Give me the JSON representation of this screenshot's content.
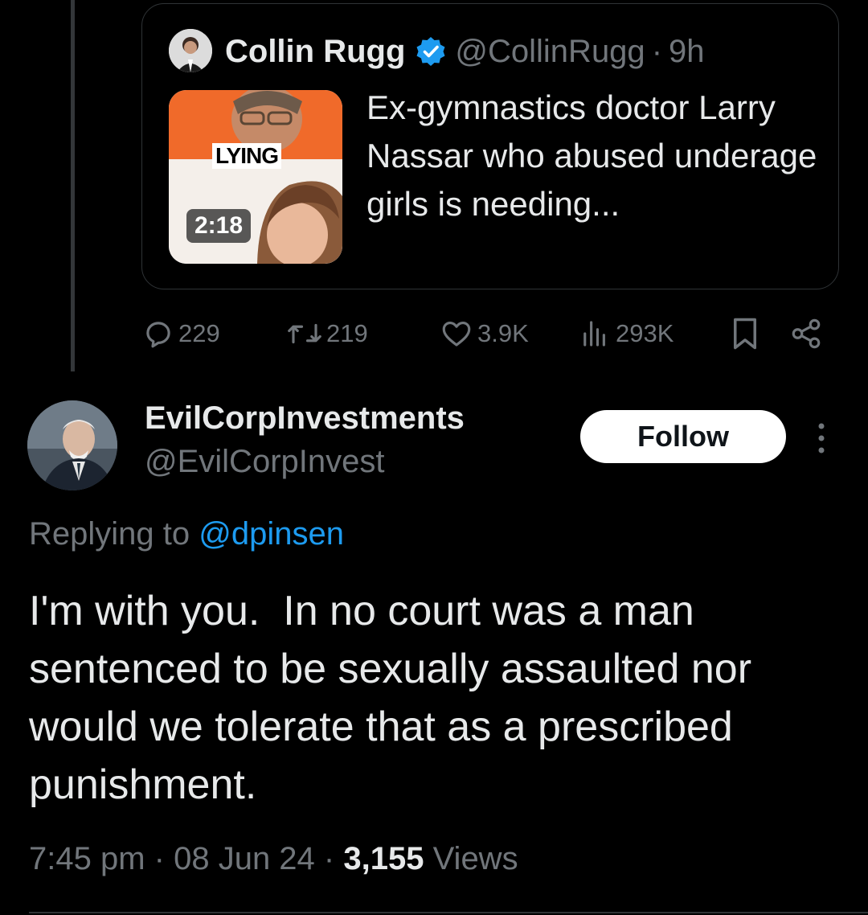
{
  "quoted_tweet": {
    "author_name": "Collin Rugg",
    "author_handle": "@CollinRugg",
    "separator": "·",
    "age": "9h",
    "text": "Ex-gymnastics doctor Larry Nassar who abused underage girls is needing...",
    "media": {
      "caption": "LYING",
      "duration": "2:18"
    }
  },
  "actions": {
    "replies": "229",
    "reposts": "219",
    "likes": "3.9K",
    "views": "293K"
  },
  "reply_tweet": {
    "author_name": "EvilCorpInvestments",
    "author_handle": "@EvilCorpInvest",
    "follow_label": "Follow",
    "replying_prefix": "Replying to",
    "replying_to": "@dpinsen",
    "text": "I'm with you.  In no court was a man sentenced to be sexually assaulted nor would we tolerate that as a prescribed punishment.",
    "time": "7:45 pm",
    "date": "08 Jun 24",
    "views_count": "3,155",
    "views_label": "Views"
  },
  "colors": {
    "background": "#000000",
    "text_primary": "#e7e9ea",
    "text_secondary": "#71767b",
    "accent": "#1d9bf0",
    "border": "#2f3336"
  },
  "icons": [
    "reply-icon",
    "repost-icon",
    "like-icon",
    "views-icon",
    "bookmark-icon",
    "share-icon",
    "verified-badge-icon",
    "more-icon"
  ]
}
